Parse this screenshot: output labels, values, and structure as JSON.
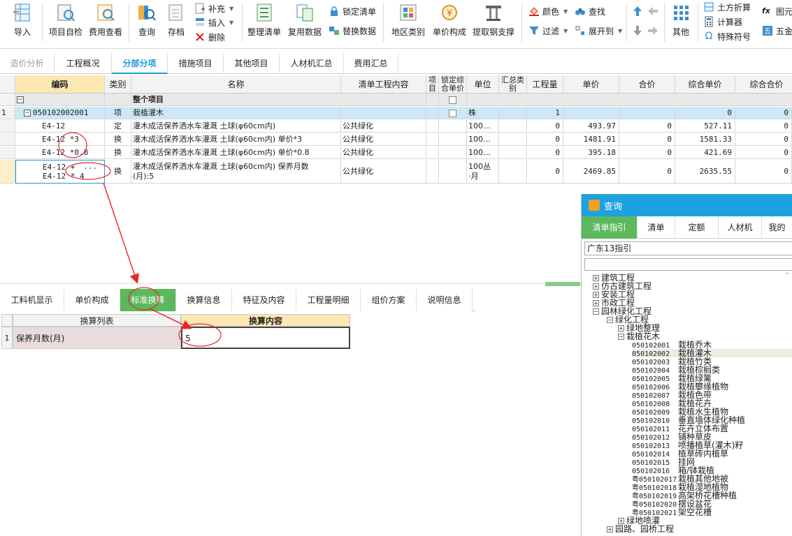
{
  "ribbon": {
    "import": "导入",
    "self_check": "项目自检",
    "fee_view": "费用查看",
    "query": "查询",
    "save": "存档",
    "supplement": "补充",
    "insert": "插入",
    "delete": "删除",
    "tidy_list": "整理清单",
    "lock_list": "锁定清单",
    "reuse_data": "复用数据",
    "replace_data": "替换数据",
    "region_category": "地区类别",
    "unit_price_comp": "单价构成",
    "extract_support": "提取钢支撑",
    "color": "颜色",
    "find": "查找",
    "filter": "过滤",
    "expand_to": "展开到",
    "other": "其他",
    "earthwork_conv": "土方折算",
    "calculator": "计算器",
    "special_symbols": "特殊符号",
    "graph_element": "图元",
    "hardware": "五金"
  },
  "main_tabs": [
    "造价分析",
    "工程概况",
    "分部分项",
    "措施项目",
    "其他项目",
    "人材机汇总",
    "费用汇总"
  ],
  "grid": {
    "headers": {
      "code": "编码",
      "category": "类别",
      "name": "名称",
      "list_content": "清单工程内容",
      "item": "项目",
      "lock_price": "锁定综合单价",
      "unit": "单位",
      "sum_category": "汇总类别",
      "quantity": "工程量",
      "unit_price": "单价",
      "total": "合价",
      "comp_unit_price": "综合单价",
      "comp_total": "综合合价"
    },
    "whole_project": "整个项目",
    "rows": [
      {
        "no": "1",
        "code": "050102002001",
        "category": "项",
        "name": "栽植灌木",
        "content": "",
        "unit": "株",
        "qty": "1",
        "price": "",
        "total": "",
        "comp_price": "0",
        "comp_total": "0"
      },
      {
        "no": "",
        "code": "E4-12",
        "category": "定",
        "name": "灌木成活保养洒水车灌溉 土球(φ60cm内)",
        "content": "公共绿化",
        "unit": "100…",
        "qty": "0",
        "price": "493.97",
        "total": "0",
        "comp_price": "527.11",
        "comp_total": "0"
      },
      {
        "no": "",
        "code": "E4-12 *3",
        "category": "换",
        "name": "灌木成活保养洒水车灌溉 土球(φ60cm内)   单价*3",
        "content": "公共绿化",
        "unit": "100…",
        "qty": "0",
        "price": "1481.91",
        "total": "0",
        "comp_price": "1581.33",
        "comp_total": "0"
      },
      {
        "no": "",
        "code": "E4-12 *0.8",
        "category": "换",
        "name": "灌木成活保养洒水车灌溉 土球(φ60cm内)   单价*0.8",
        "content": "公共绿化",
        "unit": "100…",
        "qty": "0",
        "price": "395.18",
        "total": "0",
        "comp_price": "421.69",
        "comp_total": "0"
      },
      {
        "no": "",
        "code": "E4-12 + E4-12 * 4",
        "code_line1": "E4-12 +",
        "code_line2": "E4-12 * 4",
        "category": "换",
        "name_line1": "灌木成活保养洒水车灌溉 土球(φ60cm内)   保养月数",
        "name_line2": "(月):5",
        "content": "公共绿化",
        "unit_line1": "100丛",
        "unit_line2": "·月",
        "qty": "0",
        "price": "2469.85",
        "total": "0",
        "comp_price": "2635.55",
        "comp_total": "0"
      }
    ]
  },
  "lower_tabs": [
    "工料机显示",
    "单价构成",
    "标准换算",
    "换算信息",
    "特征及内容",
    "工程量明细",
    "组价方案",
    "说明信息"
  ],
  "conversion": {
    "col_list": "换算列表",
    "col_content": "换算内容",
    "row_no": "1",
    "row_label": "保养月数(月)",
    "row_value": "5"
  },
  "query_panel": {
    "title": "查询",
    "tabs": [
      "清单指引",
      "清单",
      "定额",
      "人材机",
      "我的"
    ],
    "region": "广东13指引",
    "search_value": "",
    "tree": [
      {
        "label": "建筑工程",
        "level": 0,
        "toggle": "+"
      },
      {
        "label": "仿古建筑工程",
        "level": 0,
        "toggle": "+"
      },
      {
        "label": "安装工程",
        "level": 0,
        "toggle": "+"
      },
      {
        "label": "市政工程",
        "level": 0,
        "toggle": "+"
      },
      {
        "label": "园林绿化工程",
        "level": 0,
        "toggle": "-"
      },
      {
        "label": "绿化工程",
        "level": 1,
        "toggle": "-"
      },
      {
        "label": "绿地整理",
        "level": 2,
        "toggle": "+"
      },
      {
        "label": "栽植花木",
        "level": 2,
        "toggle": "-"
      },
      {
        "code": "050102001",
        "label": "栽植乔木",
        "level": 3
      },
      {
        "code": "050102002",
        "label": "栽植灌木",
        "level": 3,
        "selected": true
      },
      {
        "code": "050102003",
        "label": "栽植竹类",
        "level": 3
      },
      {
        "code": "050102004",
        "label": "栽植棕榈类",
        "level": 3
      },
      {
        "code": "050102005",
        "label": "栽植绿篱",
        "level": 3
      },
      {
        "code": "050102006",
        "label": "栽植攀缘植物",
        "level": 3
      },
      {
        "code": "050102007",
        "label": "栽植色带",
        "level": 3
      },
      {
        "code": "050102008",
        "label": "栽植花卉",
        "level": 3
      },
      {
        "code": "050102009",
        "label": "栽植水生植物",
        "level": 3
      },
      {
        "code": "050102010",
        "label": "垂直墙体绿化种植",
        "level": 3
      },
      {
        "code": "050102011",
        "label": "花卉立体布置",
        "level": 3
      },
      {
        "code": "050102012",
        "label": "铺种草皮",
        "level": 3
      },
      {
        "code": "050102013",
        "label": "喷播植草(灌木)籽",
        "level": 3
      },
      {
        "code": "050102014",
        "label": "植草砖内植草",
        "level": 3
      },
      {
        "code": "050102015",
        "label": "挂网",
        "level": 3
      },
      {
        "code": "050102016",
        "label": "箱/钵栽植",
        "level": 3
      },
      {
        "code": "粤050102017",
        "label": "栽植其他地被",
        "level": 3
      },
      {
        "code": "粤050102018",
        "label": "栽植湿地植物",
        "level": 3
      },
      {
        "code": "粤050102019",
        "label": "高架桥花槽种植",
        "level": 3
      },
      {
        "code": "粤050102020",
        "label": "摆设盆花",
        "level": 3
      },
      {
        "code": "粤050102021",
        "label": "架空花槽",
        "level": 3
      },
      {
        "label": "绿地喷灌",
        "level": 2,
        "toggle": "+"
      },
      {
        "label": "园路、园桥工程",
        "level": 1,
        "toggle": "+"
      }
    ]
  },
  "colors": {
    "accent_blue": "#1a9cd8",
    "tab_green": "#5cb85c",
    "code_header": "#fde7b3",
    "selected_row": "#cde8f6",
    "annotation_red": "#e8262b",
    "query_header": "#1ea1e0"
  },
  "icons": [
    "import-icon",
    "self-check-icon",
    "fee-view-icon",
    "query-icon",
    "save-icon",
    "tidy-list-icon",
    "reuse-data-icon",
    "region-icon",
    "unit-price-icon",
    "support-icon",
    "other-grid-icon"
  ]
}
